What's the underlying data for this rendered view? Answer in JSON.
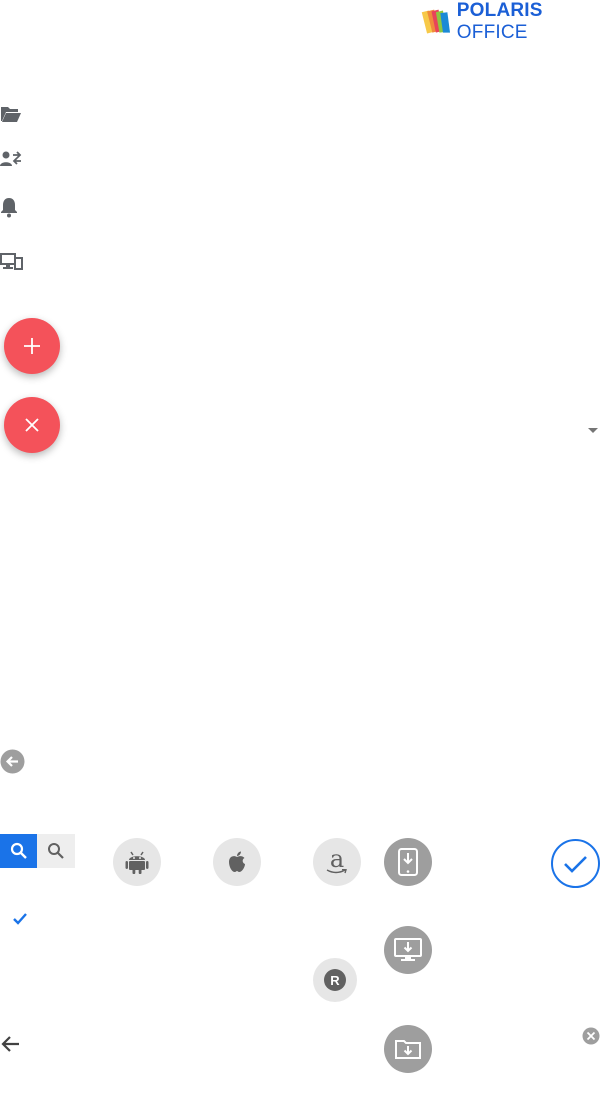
{
  "brand": {
    "name_bold": "POLARIS",
    "name_light": " OFFICE",
    "colors": {
      "primary": "#1b5fd6",
      "fab": "#f4525a",
      "accent_blue": "#1a73e8"
    }
  },
  "icons": {
    "sidebar": [
      "folder-open-icon",
      "user-share-icon",
      "bell-icon",
      "devices-icon"
    ],
    "fabs": [
      "add-icon",
      "close-icon"
    ],
    "misc": [
      "dropdown-arrow-icon",
      "back-circle-icon",
      "search-icon",
      "check-icon",
      "arrow-back-icon",
      "clear-circle-icon"
    ],
    "platforms": [
      "android-icon",
      "apple-icon",
      "amazon-icon",
      "registered-icon"
    ],
    "downloads": [
      "mobile-download-icon",
      "desktop-download-icon",
      "folder-download-icon"
    ],
    "confirm": "check-circle-icon"
  },
  "amazon": {
    "letter": "a"
  },
  "registered": {
    "letter": "R"
  }
}
